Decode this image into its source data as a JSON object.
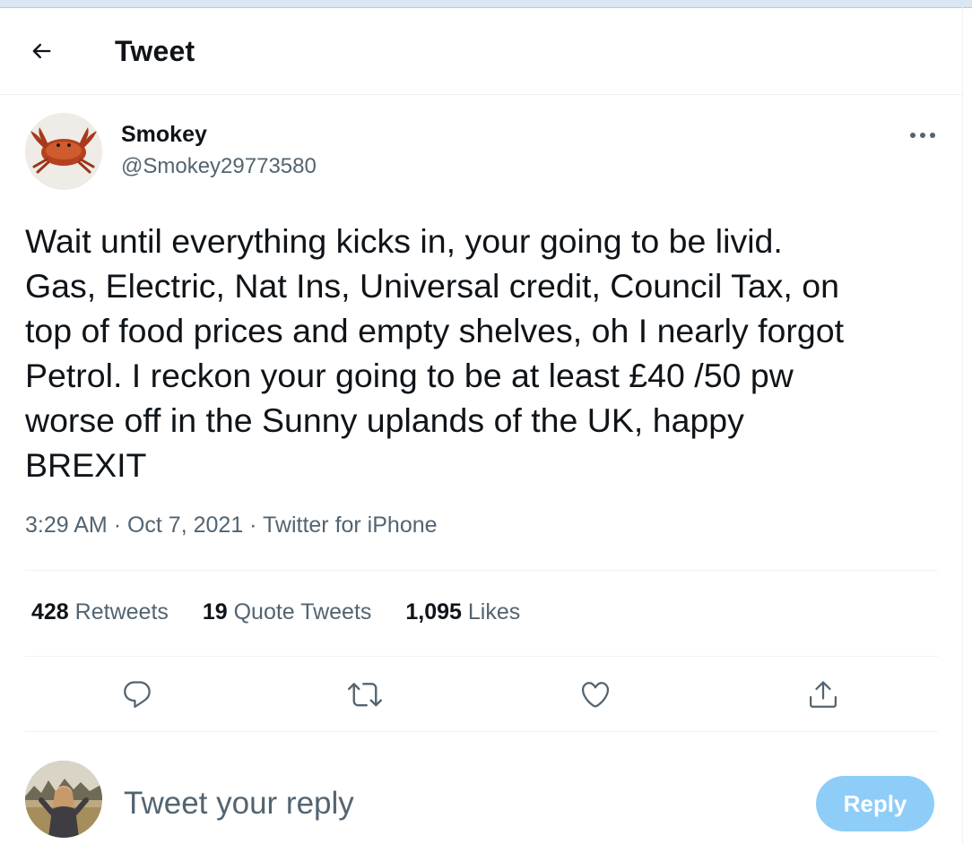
{
  "header": {
    "title": "Tweet",
    "back_icon": "arrow-left-icon"
  },
  "tweet": {
    "author_name": "Smokey",
    "author_handle": "@Smokey29773580",
    "avatar": "crab-avatar",
    "text": "Wait until everything kicks in, your going to be livid.\nGas, Electric, Nat Ins, Universal credit, Council Tax, on\ntop of food prices and empty shelves, oh I nearly forgot\nPetrol. I reckon your going to be at least £40 /50 pw\nworse off in the Sunny uplands of the UK, happy\nBREXIT",
    "time": "3:29 AM",
    "date": "Oct 7, 2021",
    "source": "Twitter for iPhone",
    "separator": "·"
  },
  "stats": {
    "retweets_count": "428",
    "retweets_label": "Retweets",
    "quotes_count": "19",
    "quotes_label": "Quote Tweets",
    "likes_count": "1,095",
    "likes_label": "Likes"
  },
  "actions": [
    "reply-icon",
    "retweet-icon",
    "like-icon",
    "share-icon"
  ],
  "reply": {
    "placeholder": "Tweet your reply",
    "button_label": "Reply"
  },
  "colors": {
    "text_primary": "#0f1419",
    "text_secondary": "#536471",
    "divider": "#eff3f4",
    "reply_button_disabled": "#8ecdf8"
  }
}
